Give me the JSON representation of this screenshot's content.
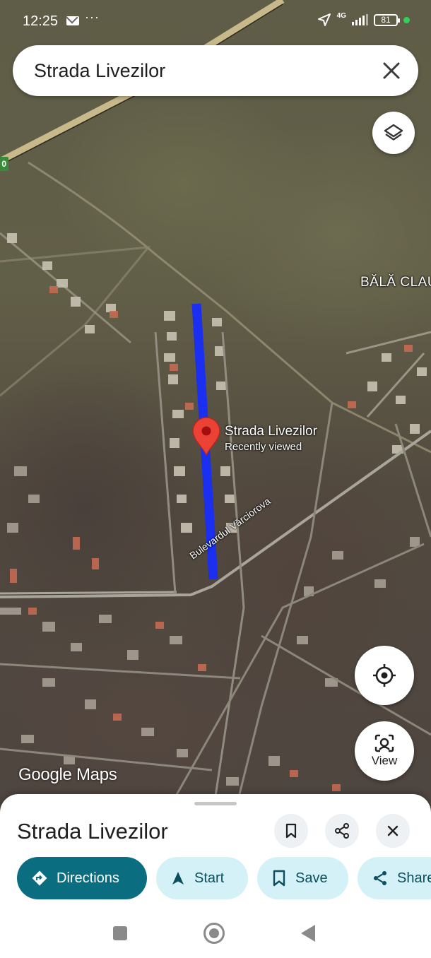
{
  "status_bar": {
    "time": "12:25",
    "dots": "···",
    "network": "4G",
    "battery": "81"
  },
  "search": {
    "query": "Strada Livezilor"
  },
  "map": {
    "area_label": "BĂLĂ CLAU",
    "place_title": "Strada Livezilor",
    "place_subtitle": "Recently viewed",
    "road_label": "Bulevardul Vărciorova",
    "route_badge": "0",
    "logo": "Google Maps",
    "route_color": "#1a2ff0",
    "pin_color": "#ea4335"
  },
  "controls": {
    "view_label": "View"
  },
  "sheet": {
    "title": "Strada Livezilor",
    "actions": [
      {
        "label": "Directions",
        "icon": "directions-icon"
      },
      {
        "label": "Start",
        "icon": "navigation-arrow-icon"
      },
      {
        "label": "Save",
        "icon": "bookmark-icon"
      },
      {
        "label": "Share",
        "icon": "share-icon"
      }
    ],
    "accent_color": "#0b6e80"
  }
}
